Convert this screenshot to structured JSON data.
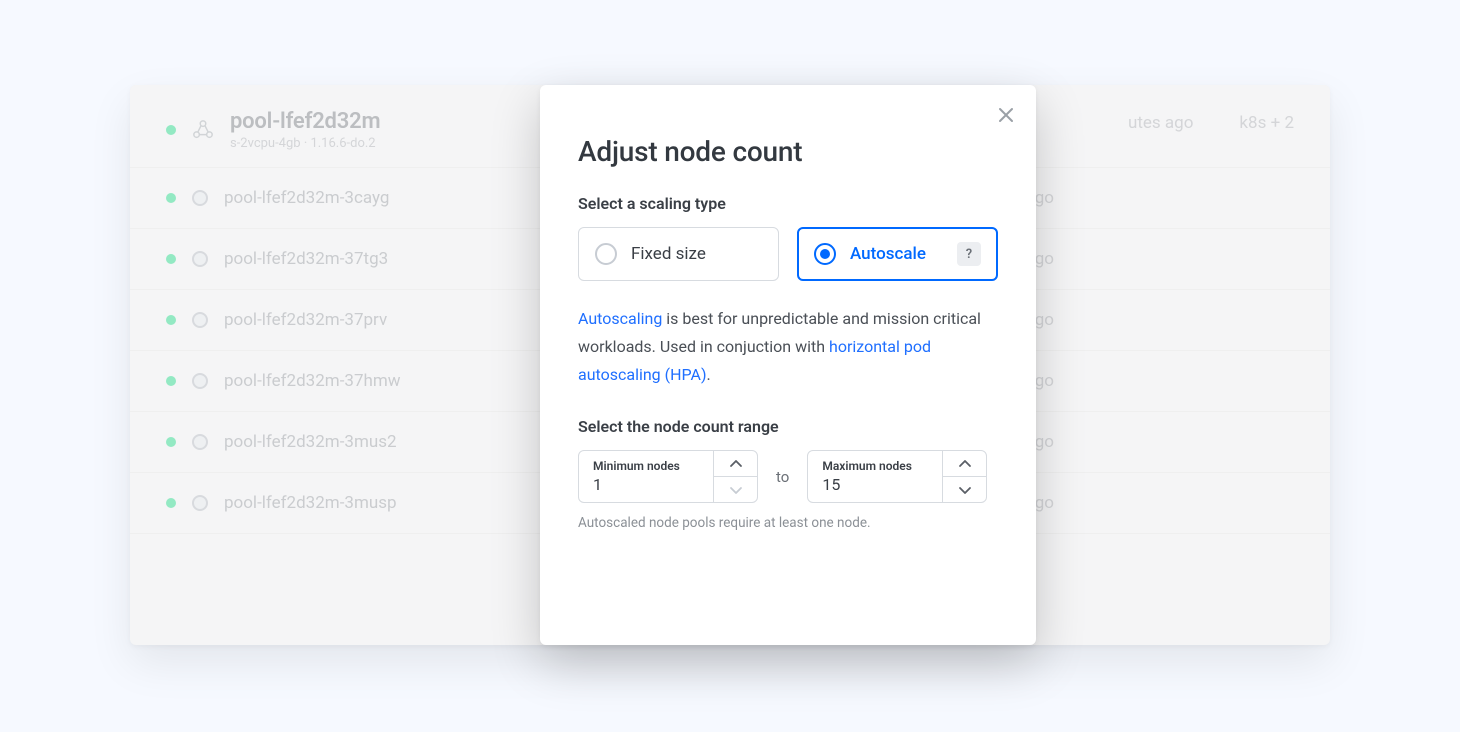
{
  "background": {
    "pool": {
      "name": "pool-lfef2d32m",
      "subtitle": "s-2vcpu-4gb · 1.16.6-do.2",
      "header_time": "utes ago",
      "tag_text": "k8s  + 2"
    },
    "nodes": [
      {
        "name": "pool-lfef2d32m-3cayg",
        "time": "days ago"
      },
      {
        "name": "pool-lfef2d32m-37tg3",
        "time": "days ago"
      },
      {
        "name": "pool-lfef2d32m-37prv",
        "time": "days ago"
      },
      {
        "name": "pool-lfef2d32m-37hmw",
        "time": "days ago"
      },
      {
        "name": "pool-lfef2d32m-3mus2",
        "time": "days ago"
      },
      {
        "name": "pool-lfef2d32m-3musp",
        "time": "days ago"
      }
    ]
  },
  "modal": {
    "title": "Adjust node count",
    "scaling_label": "Select a scaling type",
    "fixed_label": "Fixed size",
    "autoscale_label": "Autoscale",
    "help_symbol": "?",
    "desc_link1": "Autoscaling",
    "desc_text1": " is best for unpredictable and mission critical workloads. Used in conjuction with ",
    "desc_link2": "horizontal pod autoscaling (HPA)",
    "desc_period": ".",
    "range_label": "Select the node count range",
    "min_label": "Minimum nodes",
    "min_value": "1",
    "to_text": "to",
    "max_label": "Maximum nodes",
    "max_value": "15",
    "hint": "Autoscaled node pools require at least one node."
  },
  "colors": {
    "accent": "#0069ff"
  }
}
